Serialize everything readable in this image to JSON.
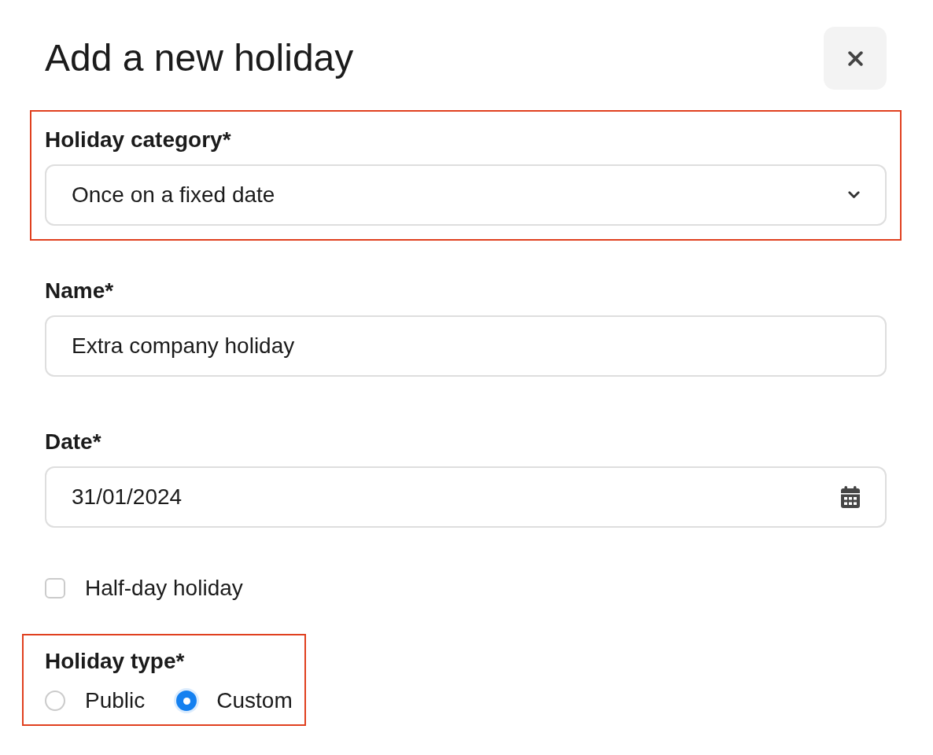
{
  "dialog": {
    "title": "Add a new holiday"
  },
  "fields": [
    {
      "kind": "select",
      "label": "Holiday category*",
      "value": "Once on a fixed date",
      "highlighted": true
    },
    {
      "kind": "text",
      "label": "Name*",
      "value": "Extra company holiday",
      "highlighted": false
    },
    {
      "kind": "date",
      "label": "Date*",
      "value": "31/01/2024",
      "highlighted": false
    },
    {
      "kind": "checkbox",
      "label": "Half-day holiday",
      "checked": false,
      "highlighted": false
    },
    {
      "kind": "radio",
      "label": "Holiday type*",
      "options": [
        {
          "label": "Public",
          "selected": false
        },
        {
          "label": "Custom",
          "selected": true
        }
      ],
      "highlighted": true
    }
  ]
}
